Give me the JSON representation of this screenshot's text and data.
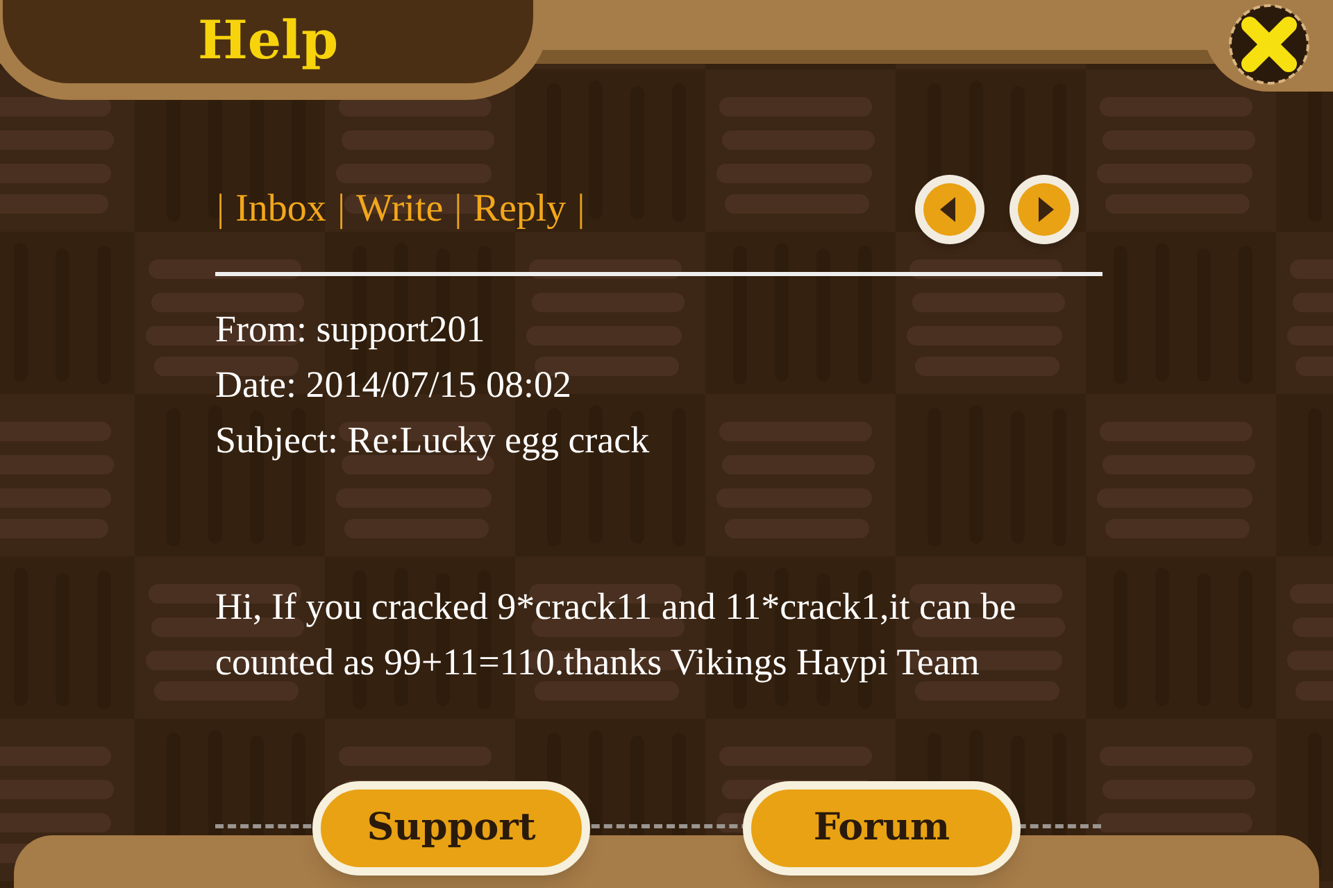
{
  "title": "Help",
  "nav": [
    {
      "kind": "separator",
      "label": "|"
    },
    {
      "kind": "link",
      "label": "Inbox"
    },
    {
      "kind": "separator",
      "label": "|"
    },
    {
      "kind": "link",
      "label": "Write"
    },
    {
      "kind": "separator",
      "label": "|"
    },
    {
      "kind": "link",
      "label": "Reply"
    },
    {
      "kind": "separator",
      "label": "|"
    }
  ],
  "message": {
    "header": [
      "From: support201",
      "Date: 2014/07/15 08:02",
      "Subject: Re:Lucky egg crack"
    ],
    "body": "Hi, If you cracked 9*crack11 and 11*crack1,it can be counted as 99+11=110.thanks Vikings Haypi Team"
  },
  "buttons": [
    "Support",
    "Forum"
  ]
}
